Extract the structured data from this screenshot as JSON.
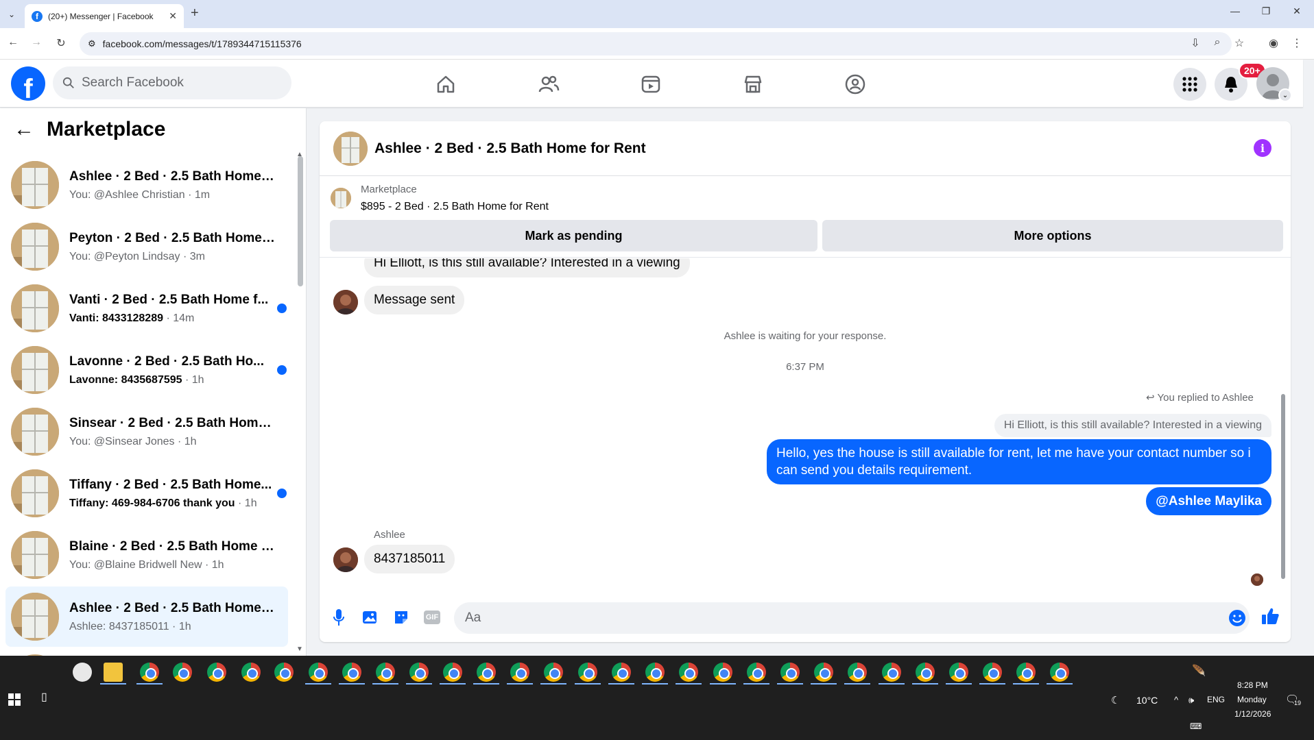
{
  "browser": {
    "tab_title": "(20+) Messenger | Facebook",
    "url": "facebook.com/messages/t/1789344715115376"
  },
  "header": {
    "search_placeholder": "Search Facebook",
    "notif_count": "20+"
  },
  "sidebar": {
    "title": "Marketplace",
    "conversations": [
      {
        "title": "Ashlee · 2 Bed · 2.5 Bath Home f...",
        "preview": "You: @Ashlee Christian",
        "time": "1m",
        "unread": false,
        "selected": false
      },
      {
        "title": "Peyton · 2 Bed · 2.5 Bath Home f...",
        "preview": "You: @Peyton Lindsay",
        "time": "3m",
        "unread": false,
        "selected": false
      },
      {
        "title": "Vanti · 2 Bed · 2.5 Bath Home f...",
        "preview": "Vanti: 8433128289",
        "time": "14m",
        "unread": true,
        "selected": false
      },
      {
        "title": "Lavonne · 2 Bed · 2.5 Bath Ho...",
        "preview": "Lavonne: 8435687595",
        "time": "1h",
        "unread": true,
        "selected": false
      },
      {
        "title": "Sinsear · 2 Bed · 2.5 Bath Home f...",
        "preview": "You: @Sinsear Jones",
        "time": "1h",
        "unread": false,
        "selected": false
      },
      {
        "title": "Tiffany · 2 Bed · 2.5 Bath Home...",
        "preview": "Tiffany: 469-984-6706 thank you",
        "time": "1h",
        "unread": true,
        "selected": false
      },
      {
        "title": "Blaine · 2 Bed · 2.5 Bath Home fo...",
        "preview": "You: @Blaine Bridwell New",
        "time": "1h",
        "unread": false,
        "selected": false
      },
      {
        "title": "Ashlee · 2 Bed · 2.5 Bath Home f...",
        "preview": "Ashlee: 8437185011",
        "time": "1h",
        "unread": false,
        "selected": true
      }
    ]
  },
  "chat": {
    "title": "Ashlee · 2 Bed · 2.5 Bath Home for Rent",
    "marketplace_label": "Marketplace",
    "listing": "$895 - 2 Bed · 2.5 Bath Home for Rent",
    "mark_pending": "Mark as pending",
    "more_options": "More options",
    "partial_msg": "Hi Elliott, is this still available? Interested in a viewing",
    "msg_sent": "Message sent",
    "waiting": "Ashlee is waiting for your response.",
    "timestamp": "6:37 PM",
    "reply_note": "You replied to Ashlee",
    "quoted": "Hi Elliott, is this still available? Interested in a viewing",
    "reply_text": "Hello, yes the house is still available for rent, let me have your contact number so i can send you details requirement.",
    "mention": "@Ashlee Maylika",
    "sender_name": "Ashlee",
    "incoming": "8437185011",
    "composer_placeholder": "Aa"
  },
  "taskbar": {
    "weather": "10°C",
    "lang": "ENG",
    "time": "8:28 PM",
    "day": "Monday",
    "date": "1/12/2026",
    "notif_count": "19"
  }
}
